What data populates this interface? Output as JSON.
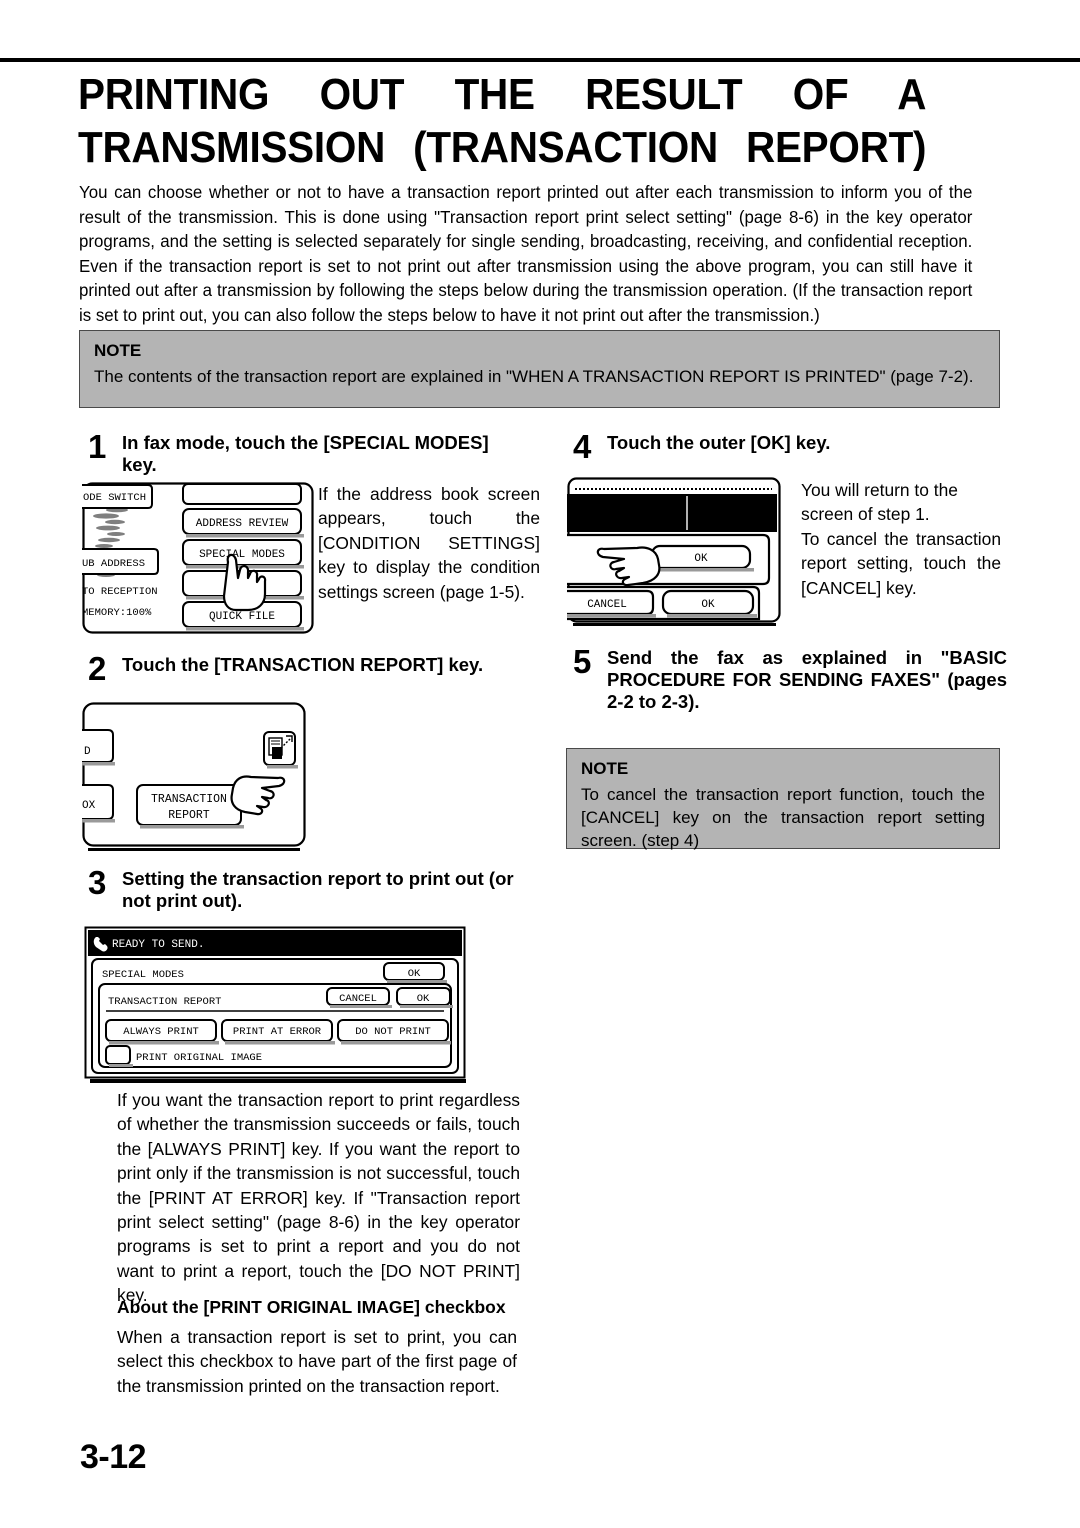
{
  "document": {
    "title": "PRINTING OUT THE RESULT OF A TRANSMISSION (TRANSACTION REPORT)",
    "title_line1": "PRINTING OUT THE RESULT OF A",
    "title_line2": "TRANSMISSION (TRANSACTION REPORT)",
    "page_number": "3-12"
  },
  "intro": {
    "text": "You can choose whether or not to have a transaction report printed out after each transmission to inform you of the result of the transmission. This is done using \"Transaction report print select setting\" (page 8-6) in the key operator programs, and the setting is selected separately for single sending, broadcasting, receiving, and confidential reception. Even if the transaction report is set to not print out after transmission using the above program, you can still have it printed out after a transmission by following the steps below during the transmission operation. (If the transaction report is set to print out, you can also follow the steps below to have it not print out after the transmission.)"
  },
  "note1": {
    "title": "NOTE",
    "body": "The contents of the transaction report are explained in \"WHEN A TRANSACTION REPORT IS PRINTED\" (page 7-2)."
  },
  "note2": {
    "title": "NOTE",
    "body": "To cancel the transaction report function, touch the [CANCEL] key on the transaction report setting screen. (step 4)"
  },
  "steps": [
    {
      "number": "1",
      "heading": "In fax mode, touch the [SPECIAL MODES] key.",
      "side_text": "If the address book screen appears, touch the [CONDITION SETTINGS] key to display the condition settings screen (page 1-5)."
    },
    {
      "number": "2",
      "heading": "Touch the [TRANSACTION REPORT] key."
    },
    {
      "number": "3",
      "heading": "Setting the transaction report to print out (or not print out)."
    },
    {
      "number": "4",
      "heading": "Touch the outer [OK] key.",
      "side_text_1": "You will return to the screen of step 1.",
      "side_text_2": "To cancel the transaction report setting, touch the [CANCEL] key."
    },
    {
      "number": "5",
      "heading": "Send the fax as explained in \"BASIC PROCEDURE FOR SENDING FAXES\" (pages 2-2 to 2-3)."
    }
  ],
  "panel1": {
    "label_mode_switch": "ODE SWITCH",
    "label_sub_address": "UB ADDRESS",
    "label_auto_reception": "TO RECEPTION",
    "label_memory": "MEMORY:100%",
    "key_address_review": "ADDRESS REVIEW",
    "key_special_modes": "SPECIAL MODES",
    "key_quick_file": "QUICK FILE",
    "key_blank": ""
  },
  "panel2": {
    "key_partial_left_top": "D",
    "key_partial_left_bottom": "OX",
    "key_transaction_report_line1": "TRANSACTION",
    "key_transaction_report_line2": "REPORT",
    "icon": "image-send-icon"
  },
  "panel3": {
    "status_message": "READY TO SEND.",
    "status_icon": "telephone-handset-icon",
    "heading_special_modes": "SPECIAL MODES",
    "heading_transaction_report": "TRANSACTION REPORT",
    "outer_ok": "OK",
    "inner_cancel": "CANCEL",
    "inner_ok": "OK",
    "key_always_print": "ALWAYS PRINT",
    "key_print_at_error": "PRINT AT ERROR",
    "key_do_not_print": "DO NOT PRINT",
    "checkbox_label": "PRINT ORIGINAL IMAGE",
    "checkbox_checked": false
  },
  "panel4": {
    "outer_ok": "OK",
    "inner_cancel": "CANCEL",
    "inner_ok": "OK"
  },
  "body": {
    "choice_paragraph": "If you want the transaction report to print regardless of whether the transmission succeeds or fails, touch the [ALWAYS PRINT] key. If you want the report to print only if the transmission is not successful, touch the [PRINT AT ERROR] key. If \"Transaction report print select setting\" (page 8-6) in the key operator programs is set to print a report and you do not want to print a report, touch the [DO NOT PRINT] key.",
    "subheading": "About the [PRINT ORIGINAL IMAGE] checkbox",
    "checkbox_paragraph": "When a transaction report is set to print, you can select this checkbox to have part of the first page of the transmission printed on the transaction report."
  },
  "colors": {
    "note_background": "#b4b4b4",
    "note_border": "#4a4a4a",
    "text": "#000000",
    "lcd_status_bar": "#000000"
  }
}
